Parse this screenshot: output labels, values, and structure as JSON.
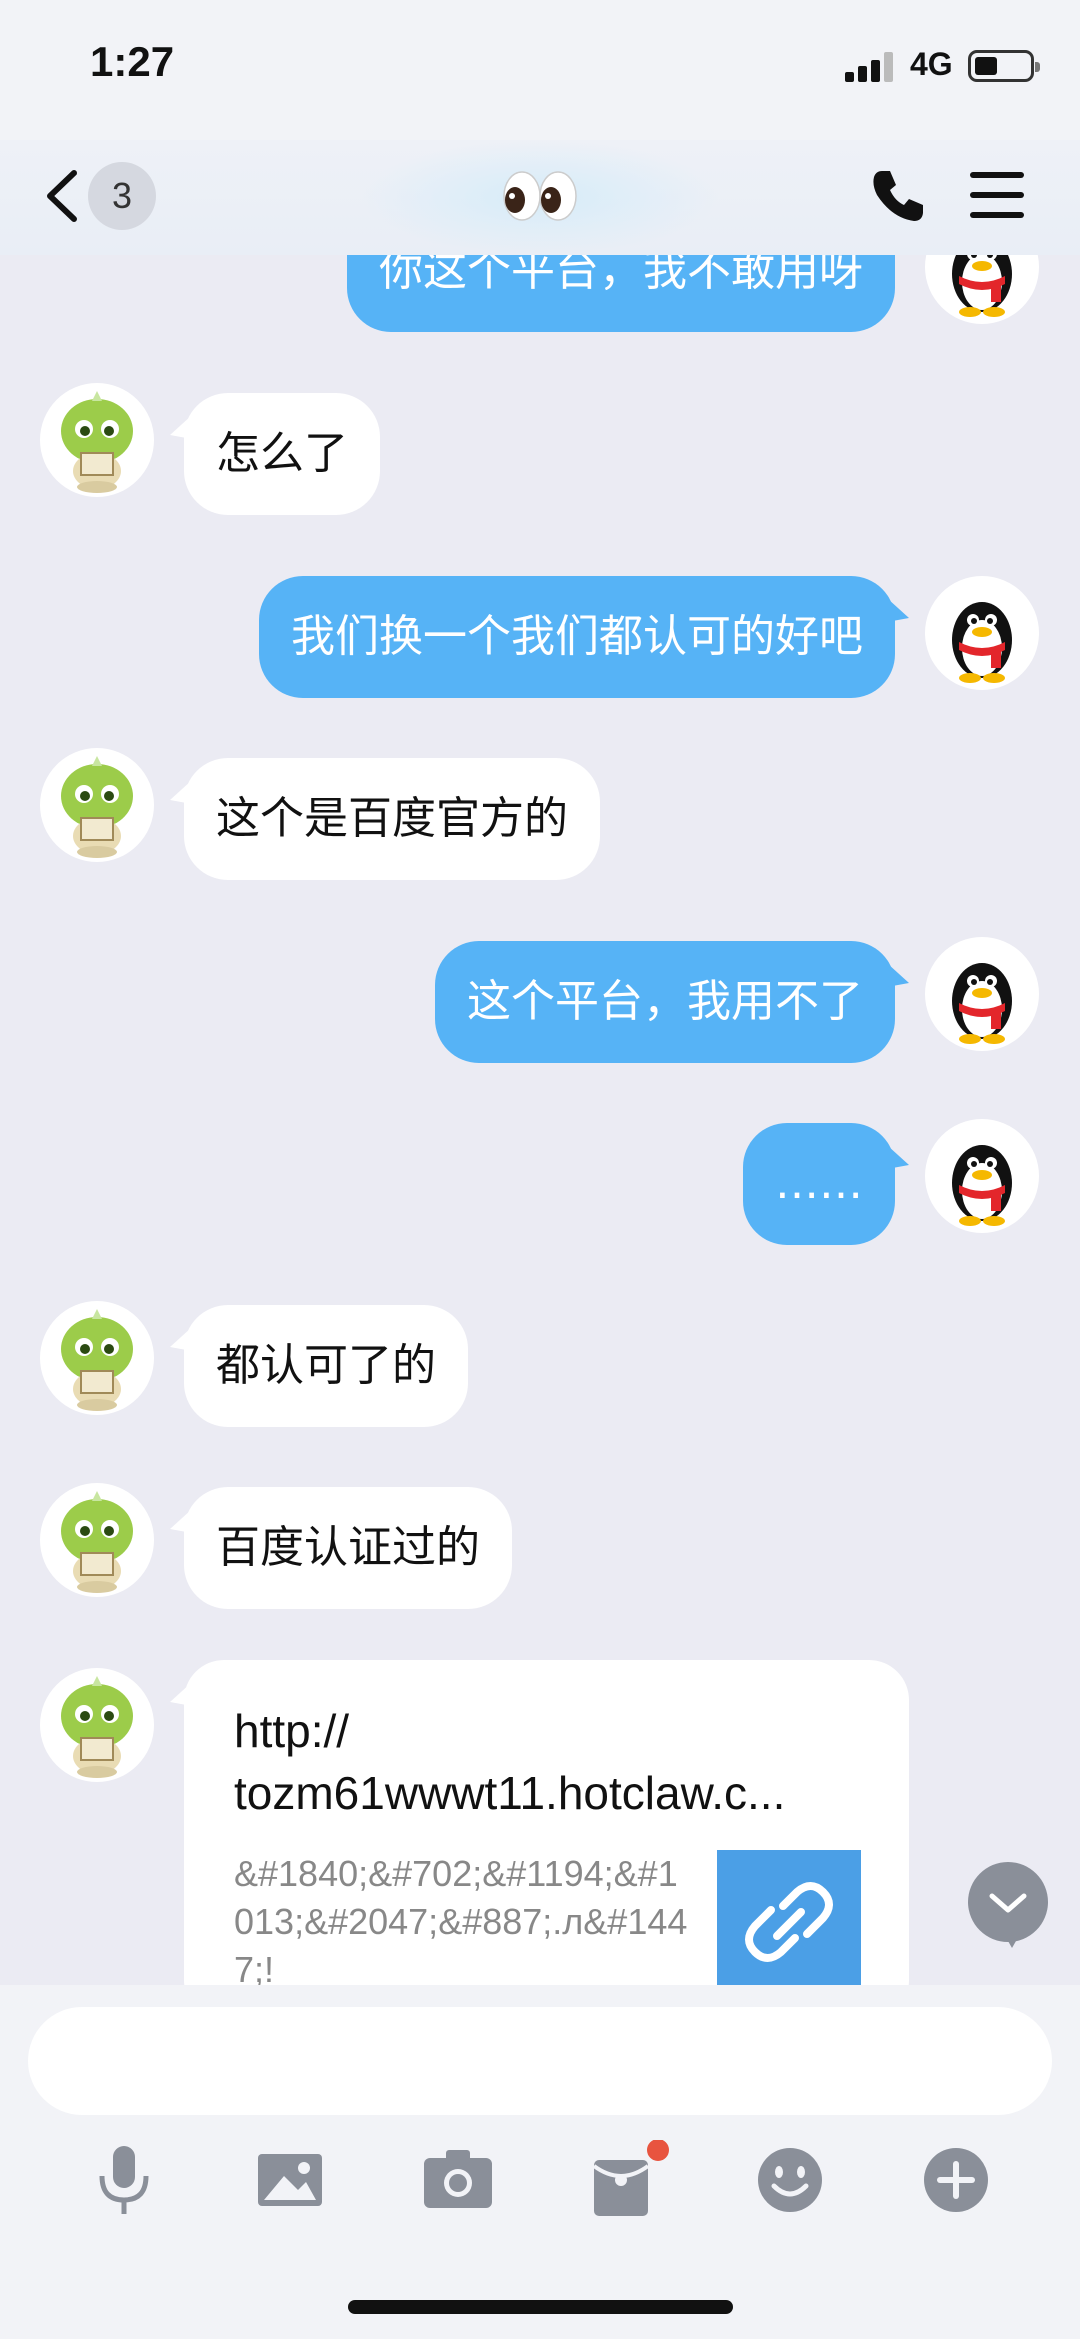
{
  "status_bar": {
    "time": "1:27",
    "network": "4G"
  },
  "header": {
    "unread_count": "3",
    "title_emoji": "👀"
  },
  "messages": [
    {
      "side": "out",
      "text": "你这个平台，我不敢用呀"
    },
    {
      "side": "in",
      "text": "怎么了"
    },
    {
      "side": "out",
      "text": "我们换一个我们都认可的好吧"
    },
    {
      "side": "in",
      "text": "这个是百度官方的"
    },
    {
      "side": "out",
      "text": "这个平台，我用不了"
    },
    {
      "side": "out",
      "text": "……"
    },
    {
      "side": "in",
      "text": "都认可了的"
    },
    {
      "side": "in",
      "text": "百度认证过的"
    }
  ],
  "link_card": {
    "url_line1": "http://",
    "url_line2": "tozm61wwwt11.hotclaw.c...",
    "description": "&#1840;&#702;&#1194;&#1013;&#2047;&#887;.л&#1447;!"
  },
  "input": {
    "value": ""
  },
  "toolbar_icons": [
    "microphone-icon",
    "image-icon",
    "camera-icon",
    "red-packet-icon",
    "emoji-icon",
    "plus-icon"
  ],
  "colors": {
    "outgoing_bubble": "#56b3f6",
    "incoming_bubble": "#ffffff",
    "background": "#ebebf3",
    "badge_dot": "#e8543f"
  }
}
